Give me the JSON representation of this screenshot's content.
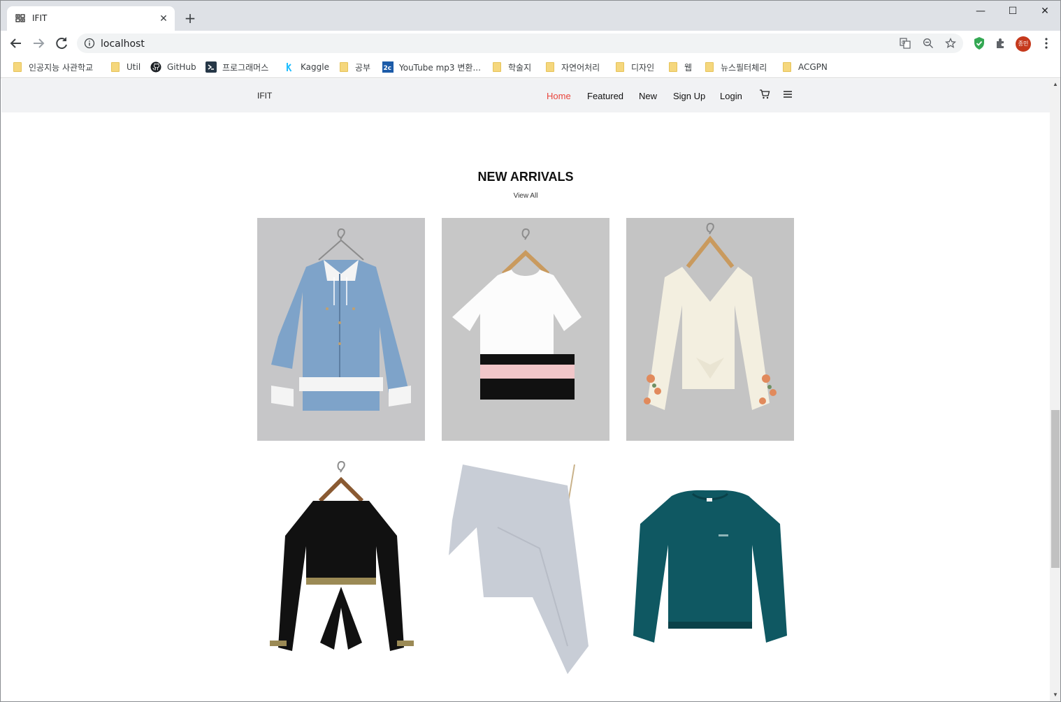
{
  "browser": {
    "tab_title": "IFIT",
    "tab_close": "✕",
    "new_tab": "+",
    "window_controls": {
      "minimize": "—",
      "maximize": "☐",
      "close": "✕"
    },
    "url": "localhost",
    "profile_initials": "종민",
    "bookmarks": [
      {
        "label": "인공지능 사관학교",
        "icon": "folder-icon"
      },
      {
        "label": "Util",
        "icon": "folder-icon"
      },
      {
        "label": "GitHub",
        "icon": "github-icon"
      },
      {
        "label": "프로그래머스",
        "icon": "programmers-icon"
      },
      {
        "label": "Kaggle",
        "icon": "kaggle-icon"
      },
      {
        "label": "공부",
        "icon": "folder-icon"
      },
      {
        "label": "YouTube mp3 변환...",
        "icon": "2conv-icon"
      },
      {
        "label": "학술지",
        "icon": "folder-icon"
      },
      {
        "label": "자연어처리",
        "icon": "folder-icon"
      },
      {
        "label": "디자인",
        "icon": "folder-icon"
      },
      {
        "label": "웹",
        "icon": "folder-icon"
      },
      {
        "label": "뉴스필터체리",
        "icon": "folder-icon"
      },
      {
        "label": "ACGPN",
        "icon": "folder-icon"
      }
    ]
  },
  "site": {
    "brand": "IFIT",
    "nav": {
      "home": "Home",
      "featured": "Featured",
      "new": "New",
      "signup": "Sign Up",
      "login": "Login"
    },
    "accent_color": "#e8453c",
    "section_title": "NEW ARRIVALS",
    "view_all": "View All",
    "products": [
      {
        "name": "denim-hooded-jacket"
      },
      {
        "name": "striped-crop-tee"
      },
      {
        "name": "floral-sleeve-tie-blouse"
      },
      {
        "name": "black-tie-crop-top"
      },
      {
        "name": "grey-one-shoulder-top"
      },
      {
        "name": "teal-sweatshirt"
      }
    ]
  }
}
